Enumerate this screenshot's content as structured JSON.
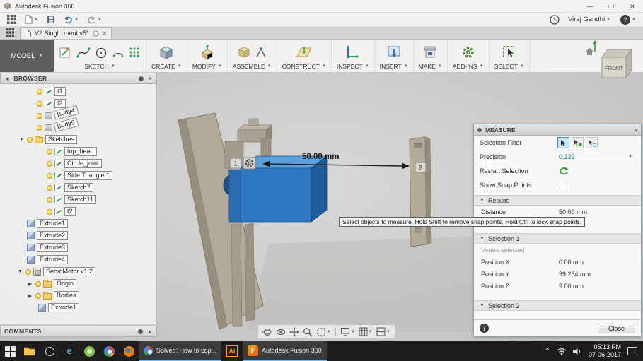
{
  "titlebar": {
    "title": "Autodesk Fusion 360"
  },
  "qat": {
    "user": "Viraj Gandhi"
  },
  "tab": {
    "label": "V2 Singl...ment v5*"
  },
  "ribbon": {
    "model_label": "MODEL",
    "groups": [
      {
        "label": "SKETCH"
      },
      {
        "label": "CREATE"
      },
      {
        "label": "MODIFY"
      },
      {
        "label": "ASSEMBLE"
      },
      {
        "label": "CONSTRUCT"
      },
      {
        "label": "INSPECT"
      },
      {
        "label": "INSERT"
      },
      {
        "label": "MAKE"
      },
      {
        "label": "ADD-INS"
      },
      {
        "label": "SELECT"
      }
    ]
  },
  "viewcube": {
    "face": "FRONT"
  },
  "browser": {
    "title": "BROWSER",
    "items": [
      {
        "label": "t1",
        "icon": "sketch-icon"
      },
      {
        "label": "t2",
        "icon": "sketch-icon"
      },
      {
        "label": "Body4",
        "icon": "body-icon"
      },
      {
        "label": "Body5",
        "icon": "body-icon"
      },
      {
        "label": "Sketches",
        "icon": "folder-icon"
      },
      {
        "label": "top_head",
        "icon": "sketch-icon"
      },
      {
        "label": "Circle_joint",
        "icon": "sketch-icon"
      },
      {
        "label": "Side Triangle 1",
        "icon": "sketch-icon"
      },
      {
        "label": "Sketch7",
        "icon": "sketch-icon"
      },
      {
        "label": "Sketch11",
        "icon": "sketch-icon"
      },
      {
        "label": "t2",
        "icon": "sketch-icon"
      },
      {
        "label": "Extrude1",
        "icon": "extrude-icon"
      },
      {
        "label": "Extrude2",
        "icon": "extrude-icon"
      },
      {
        "label": "Extrude3",
        "icon": "extrude-icon"
      },
      {
        "label": "Extrude4",
        "icon": "extrude-icon"
      },
      {
        "label": "ServoMotor v1:2",
        "icon": "component-icon"
      },
      {
        "label": "Origin",
        "icon": "folder-icon"
      },
      {
        "label": "Bodies",
        "icon": "folder-icon"
      },
      {
        "label": "Extrude1",
        "icon": "extrude-icon"
      }
    ]
  },
  "comments": {
    "title": "COMMENTS"
  },
  "viewport": {
    "dimension_label": "50.00 mm",
    "marker1": "1",
    "marker2": "2",
    "tooltip": "Select objects to measure. Hold Shift to remove snap points. Hold Ctrl to lock snap points."
  },
  "measure": {
    "title": "MEASURE",
    "selection_filter_label": "Selection Filter",
    "precision_label": "Precision",
    "precision_value": "0.123",
    "restart_label": "Restart Selection",
    "snap_points_label": "Show Snap Points",
    "results_header": "Results",
    "distance_label": "Distance",
    "distance_value": "50.00 mm",
    "selection1_header": "Selection 1",
    "selection1_status": "Vertex selected",
    "pos_x_label": "Position X",
    "pos_x_value": "0.00 mm",
    "pos_y_label": "Position Y",
    "pos_y_value": "39.264 mm",
    "pos_z_label": "Position Z",
    "pos_z_value": "9.00 mm",
    "selection2_header": "Selection 2",
    "close_label": "Close"
  },
  "taskbar": {
    "chrome_window": "Solved: How to cop...",
    "illustrator_label": "Ai",
    "fusion_initial": "F",
    "fusion_window": "Autodesk Fusion 360",
    "time": "05:13 PM",
    "date": "07-06-2017"
  },
  "colors": {
    "servo_blue": "#2f77c0",
    "plate_beige": "#b2aa99",
    "precision_teal": "#1a7f8a",
    "taskbar_dark": "#1d1d1d"
  }
}
